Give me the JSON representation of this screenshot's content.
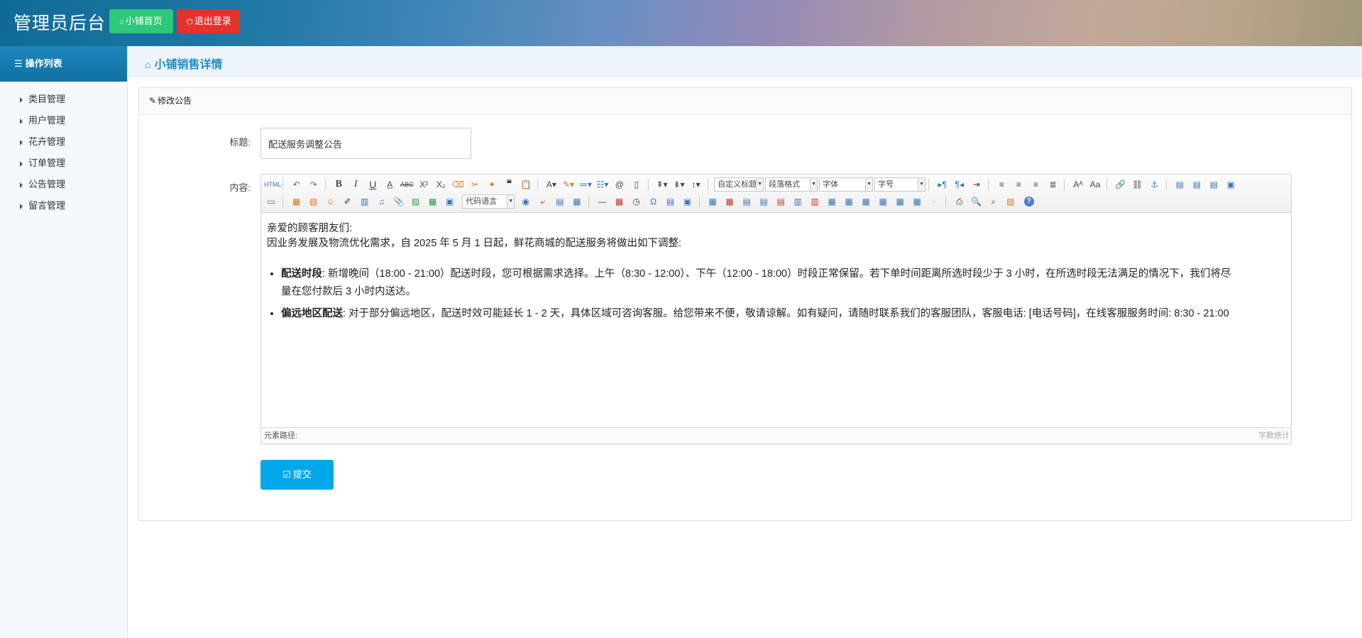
{
  "header": {
    "brand": "管理员后台",
    "home_button": "小铺首页",
    "logout_button": "退出登录"
  },
  "sidebar": {
    "title": "操作列表",
    "items": [
      {
        "label": "类目管理"
      },
      {
        "label": "用户管理"
      },
      {
        "label": "花卉管理"
      },
      {
        "label": "订单管理"
      },
      {
        "label": "公告管理"
      },
      {
        "label": "留言管理"
      }
    ]
  },
  "page": {
    "crumb": "小铺销售详情"
  },
  "panel": {
    "title": "修改公告",
    "title_label": "标题:",
    "content_label": "内容:",
    "title_value": "配送服务调整公告",
    "submit": "提交"
  },
  "editor": {
    "selects": {
      "code_language": "代码语言",
      "custom_title": "自定义标题",
      "paragraph": "段落格式",
      "font": "字体",
      "font_size": "字号"
    },
    "content": {
      "greeting": "亲爱的顾客朋友们:",
      "intro": "因业务发展及物流优化需求，自 2025 年 5 月 1 日起，鲜花商城的配送服务将做出如下调整:",
      "item1_title": "配送时段",
      "item1_text": ": 新增晚间（18:00 - 21:00）配送时段，您可根据需求选择。上午（8:30 - 12:00）、下午（12:00 - 18:00）时段正常保留。若下单时间距离所选时段少于 3 小时，在所选时段无法满足的情况下，我们将尽量在您付款后 3 小时内送达。",
      "item2_title": "偏远地区配送",
      "item2_text": ": 对于部分偏远地区，配送时效可能延长 1 - 2 天，具体区域可咨询客服。给您带来不便，敬请谅解。如有疑问，请随时联系我们的客服团队，客服电话: [电话号码]，在线客服服务时间: 8:30 - 21:00"
    },
    "status_path": "元素路径:",
    "status_count": "字数统计"
  },
  "colors": {
    "accent": "#1f8ec7",
    "home_button": "#2ec87a",
    "logout_button": "#e5322d",
    "submit_button": "#00a8ea"
  }
}
